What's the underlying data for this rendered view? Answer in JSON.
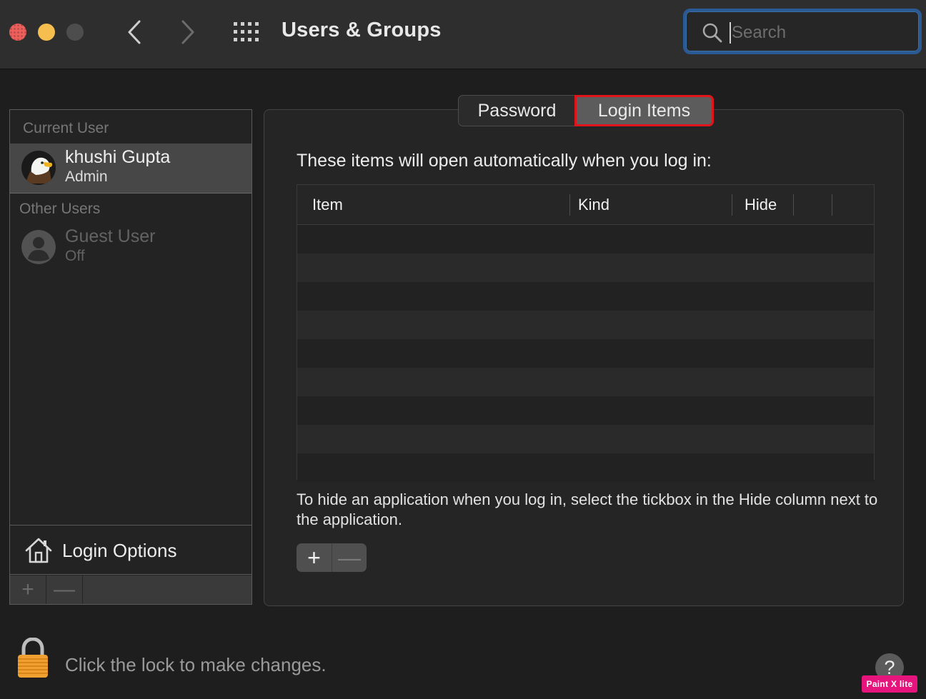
{
  "window": {
    "title": "Users & Groups",
    "search": {
      "placeholder": "Search",
      "value": ""
    }
  },
  "sidebar": {
    "current_user_header": "Current User",
    "current_user": {
      "name": "khushi Gupta",
      "role": "Admin"
    },
    "other_users_header": "Other Users",
    "other_users": [
      {
        "name": "Guest User",
        "status": "Off"
      }
    ],
    "login_options_label": "Login Options",
    "footer": {
      "add_label": "+",
      "remove_label": "—"
    }
  },
  "tabs": [
    {
      "label": "Password",
      "selected": false
    },
    {
      "label": "Login Items",
      "selected": true
    }
  ],
  "login_items": {
    "intro": "These items will open automatically when you log in:",
    "columns": [
      "Item",
      "Kind",
      "Hide"
    ],
    "rows": [],
    "hint": "To hide an application when you log in, select the tickbox in the Hide column next to the application.",
    "add_label": "+",
    "remove_label": "—"
  },
  "footer": {
    "lock_text": "Click the lock to make changes.",
    "help_label": "?"
  },
  "watermark": "Paint X lite",
  "colors": {
    "tab_highlight": "#e0141b",
    "search_focus": "#2a5a93",
    "close": "#ec5f5b",
    "minimize": "#f5be4f",
    "watermark": "#e6157e"
  },
  "icons": [
    "chevron-left-icon",
    "chevron-right-icon",
    "grid-icon",
    "search-icon",
    "house-icon",
    "lock-icon",
    "help-icon"
  ]
}
